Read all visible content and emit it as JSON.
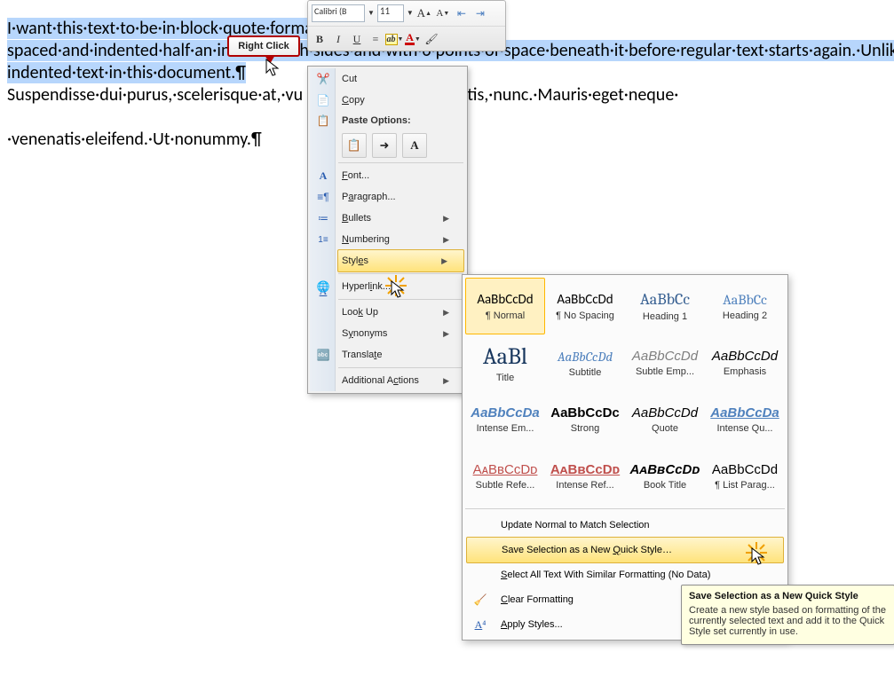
{
  "doc": {
    "p1": "I·want·this·text·to·be·in·block·quote·format,·meaning·it's·single-spaced·and·indented·half·an·inch·on·both·sides·and·with·6·points·of·space·beneath·it·before·regular·text·starts·again.·Unlike·the·text·above·and·below·it,·it·will·not·have·the·first·line·indented.·I·want·to·be·able·to·use·this·Style·to·control·all·paragraph-indented·text·in·this·document.¶",
    "p2a": "Suspendisse·dui·purus,·scelerisque·at,·vu",
    "p2b": "·mattis,·nunc.·Mauris·eget·neque·",
    "p3": "·venenatis·eleifend.·Ut·nonummy.¶"
  },
  "miniToolbar": {
    "font": "Calibri (B",
    "size": "11",
    "growA": "A",
    "shrinkA": "A",
    "bold": "B",
    "italic": "I",
    "underline": "U",
    "center": "≡",
    "highlight": "ab",
    "fontcolor": "A"
  },
  "callout": "Right Click",
  "menu": {
    "cut": "Cut",
    "copy": "Copy",
    "pasteHeader": "Paste Options:",
    "font": "Font...",
    "paragraph": "Paragraph...",
    "bullets": "Bullets",
    "numbering": "Numbering",
    "styles": "Styles",
    "hyperlink": "Hyperlink...",
    "lookup": "Look Up",
    "synonyms": "Synonyms",
    "translate": "Translate",
    "additional": "Additional Actions"
  },
  "styles": {
    "grid": [
      {
        "sample": "AaBbCcDd",
        "name": "¶ Normal",
        "css": "font-family:Calibri;font-size:15px;"
      },
      {
        "sample": "AaBbCcDd",
        "name": "¶ No Spacing",
        "css": "font-family:Calibri;font-size:15px;"
      },
      {
        "sample": "AaBbCc",
        "name": "Heading 1",
        "css": "font-family:Cambria,serif;font-size:18px;color:#365f91;"
      },
      {
        "sample": "AaBbCc",
        "name": "Heading 2",
        "css": "font-family:Cambria,serif;font-size:16px;color:#4f81bd;"
      },
      {
        "sample": "AaBl",
        "name": "Title",
        "css": "font-family:Cambria,serif;font-size:26px;color:#17365d;"
      },
      {
        "sample": "AaBbCcDd",
        "name": "Subtitle",
        "css": "font-family:Cambria,serif;font-size:15px;font-style:italic;color:#4f81bd;"
      },
      {
        "sample": "AaBbCcDd",
        "name": "Subtle Emp...",
        "css": "font-style:italic;color:#7f7f7f;font-size:15px;"
      },
      {
        "sample": "AaBbCcDd",
        "name": "Emphasis",
        "css": "font-style:italic;font-size:15px;"
      },
      {
        "sample": "AaBbCcDa",
        "name": "Intense Em...",
        "css": "font-style:italic;font-weight:bold;color:#4f81bd;font-size:15px;"
      },
      {
        "sample": "AaBbCcDc",
        "name": "Strong",
        "css": "font-weight:bold;font-size:15px;"
      },
      {
        "sample": "AaBbCcDd",
        "name": "Quote",
        "css": "font-style:italic;font-size:15px;"
      },
      {
        "sample": "AaBbCcDa",
        "name": "Intense Qu...",
        "css": "font-style:italic;font-weight:bold;color:#4f81bd;text-decoration:underline;font-size:15px;"
      },
      {
        "sample": "AᴀBʙCᴄDᴅ",
        "name": "Subtle Refe...",
        "css": "color:#c0504d;text-decoration:underline;font-variant:small-caps;font-size:15px;"
      },
      {
        "sample": "AᴀBʙCᴄDᴅ",
        "name": "Intense Ref...",
        "css": "color:#c0504d;font-weight:bold;text-decoration:underline;font-variant:small-caps;font-size:15px;"
      },
      {
        "sample": "AᴀBʙCᴄDᴅ",
        "name": "Book Title",
        "css": "font-weight:bold;font-style:italic;font-variant:small-caps;font-size:15px;"
      },
      {
        "sample": "AaBbCcDd",
        "name": "¶ List Parag...",
        "css": "font-size:15px;"
      }
    ],
    "updateNormal": "Update Normal to Match Selection",
    "saveNew": "Save Selection as a New Quick Style…",
    "selectSimilar": "Select All Text With Similar Formatting (No Data)",
    "clearFmt": "Clear Formatting",
    "applyStyles": "Apply Styles..."
  },
  "tooltip": {
    "title": "Save Selection as a New Quick Style",
    "body": "Create a new style based on formatting of the currently selected text and add it to the Quick Style set currently in use."
  }
}
